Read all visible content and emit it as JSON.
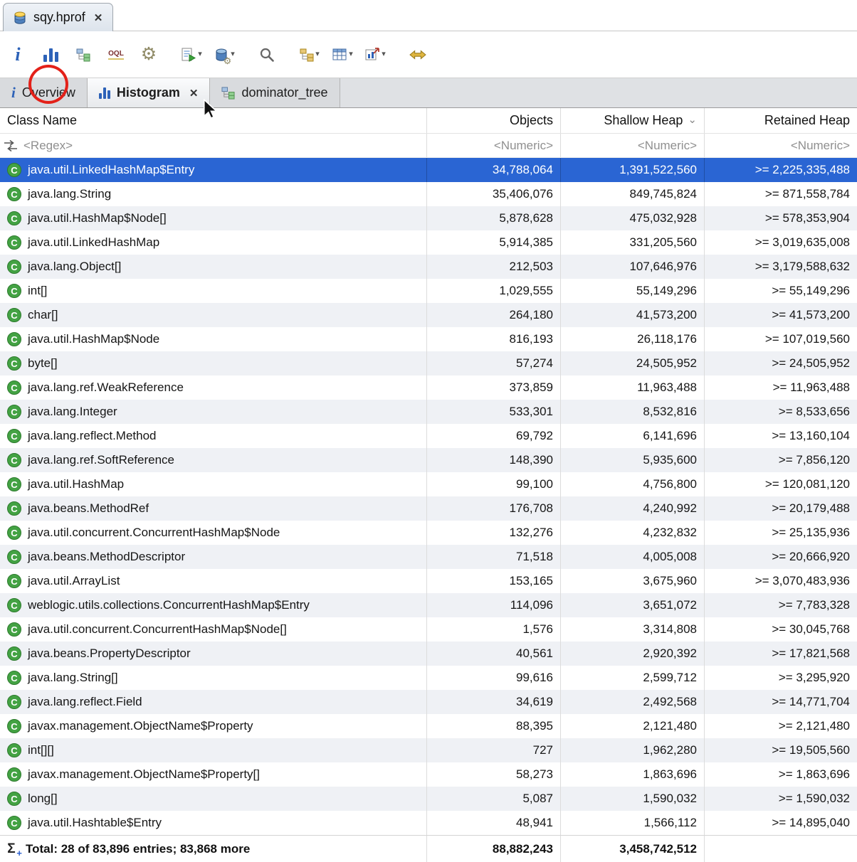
{
  "icons": {
    "close": "✕",
    "caret": "▾",
    "sort_desc": "⌄",
    "gear": "⚙",
    "sigma": "Σ",
    "plus": "+",
    "oql": "OQL",
    "info": "i",
    "class_letter": "C",
    "toolbar_names": [
      "info-icon",
      "histogram-icon",
      "dominator-tree-icon",
      "oql-icon",
      "settings-gear-icon",
      "run-expert-report-icon",
      "query-browser-icon",
      "search-icon",
      "group-by-icon",
      "table-columns-icon",
      "export-icon",
      "compare-icon"
    ]
  },
  "editor_tab": {
    "title": "sqy.hprof"
  },
  "view_tabs": {
    "overview": "Overview",
    "histogram": "Histogram",
    "dominator_tree": "dominator_tree"
  },
  "table": {
    "columns": {
      "class_name": "Class Name",
      "objects": "Objects",
      "shallow": "Shallow Heap",
      "retained": "Retained Heap"
    },
    "filters": {
      "class_name": "<Regex>",
      "objects": "<Numeric>",
      "shallow": "<Numeric>",
      "retained": "<Numeric>"
    },
    "rows": [
      {
        "name": "java.util.LinkedHashMap$Entry",
        "objects": "34,788,064",
        "shallow": "1,391,522,560",
        "retained": ">= 2,225,335,488",
        "selected": true
      },
      {
        "name": "java.lang.String",
        "objects": "35,406,076",
        "shallow": "849,745,824",
        "retained": ">= 871,558,784"
      },
      {
        "name": "java.util.HashMap$Node[]",
        "objects": "5,878,628",
        "shallow": "475,032,928",
        "retained": ">= 578,353,904"
      },
      {
        "name": "java.util.LinkedHashMap",
        "objects": "5,914,385",
        "shallow": "331,205,560",
        "retained": ">= 3,019,635,008"
      },
      {
        "name": "java.lang.Object[]",
        "objects": "212,503",
        "shallow": "107,646,976",
        "retained": ">= 3,179,588,632"
      },
      {
        "name": "int[]",
        "objects": "1,029,555",
        "shallow": "55,149,296",
        "retained": ">= 55,149,296"
      },
      {
        "name": "char[]",
        "objects": "264,180",
        "shallow": "41,573,200",
        "retained": ">= 41,573,200"
      },
      {
        "name": "java.util.HashMap$Node",
        "objects": "816,193",
        "shallow": "26,118,176",
        "retained": ">= 107,019,560"
      },
      {
        "name": "byte[]",
        "objects": "57,274",
        "shallow": "24,505,952",
        "retained": ">= 24,505,952"
      },
      {
        "name": "java.lang.ref.WeakReference",
        "objects": "373,859",
        "shallow": "11,963,488",
        "retained": ">= 11,963,488"
      },
      {
        "name": "java.lang.Integer",
        "objects": "533,301",
        "shallow": "8,532,816",
        "retained": ">= 8,533,656"
      },
      {
        "name": "java.lang.reflect.Method",
        "objects": "69,792",
        "shallow": "6,141,696",
        "retained": ">= 13,160,104"
      },
      {
        "name": "java.lang.ref.SoftReference",
        "objects": "148,390",
        "shallow": "5,935,600",
        "retained": ">= 7,856,120"
      },
      {
        "name": "java.util.HashMap",
        "objects": "99,100",
        "shallow": "4,756,800",
        "retained": ">= 120,081,120"
      },
      {
        "name": "java.beans.MethodRef",
        "objects": "176,708",
        "shallow": "4,240,992",
        "retained": ">= 20,179,488"
      },
      {
        "name": "java.util.concurrent.ConcurrentHashMap$Node",
        "objects": "132,276",
        "shallow": "4,232,832",
        "retained": ">= 25,135,936"
      },
      {
        "name": "java.beans.MethodDescriptor",
        "objects": "71,518",
        "shallow": "4,005,008",
        "retained": ">= 20,666,920"
      },
      {
        "name": "java.util.ArrayList",
        "objects": "153,165",
        "shallow": "3,675,960",
        "retained": ">= 3,070,483,936"
      },
      {
        "name": "weblogic.utils.collections.ConcurrentHashMap$Entry",
        "objects": "114,096",
        "shallow": "3,651,072",
        "retained": ">= 7,783,328"
      },
      {
        "name": "java.util.concurrent.ConcurrentHashMap$Node[]",
        "objects": "1,576",
        "shallow": "3,314,808",
        "retained": ">= 30,045,768"
      },
      {
        "name": "java.beans.PropertyDescriptor",
        "objects": "40,561",
        "shallow": "2,920,392",
        "retained": ">= 17,821,568"
      },
      {
        "name": "java.lang.String[]",
        "objects": "99,616",
        "shallow": "2,599,712",
        "retained": ">= 3,295,920"
      },
      {
        "name": "java.lang.reflect.Field",
        "objects": "34,619",
        "shallow": "2,492,568",
        "retained": ">= 14,771,704"
      },
      {
        "name": "javax.management.ObjectName$Property",
        "objects": "88,395",
        "shallow": "2,121,480",
        "retained": ">= 2,121,480"
      },
      {
        "name": "int[][]",
        "objects": "727",
        "shallow": "1,962,280",
        "retained": ">= 19,505,560"
      },
      {
        "name": "javax.management.ObjectName$Property[]",
        "objects": "58,273",
        "shallow": "1,863,696",
        "retained": ">= 1,863,696"
      },
      {
        "name": "long[]",
        "objects": "5,087",
        "shallow": "1,590,032",
        "retained": ">= 1,590,032"
      },
      {
        "name": "java.util.Hashtable$Entry",
        "objects": "48,941",
        "shallow": "1,566,112",
        "retained": ">= 14,895,040"
      }
    ],
    "total": {
      "label": "Total: 28 of 83,896 entries; 83,868 more",
      "objects": "88,882,243",
      "shallow": "3,458,742,512",
      "retained": ""
    }
  }
}
